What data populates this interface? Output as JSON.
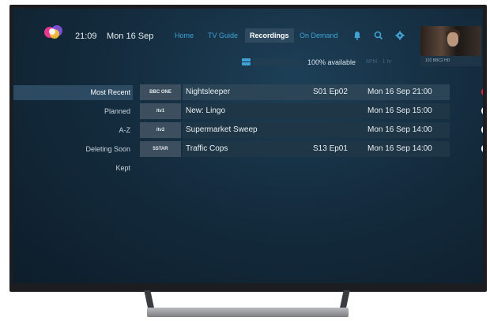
{
  "header": {
    "time": "21:09",
    "date": "Mon 16 Sep",
    "nav": [
      {
        "label": "Home"
      },
      {
        "label": "TV Guide"
      },
      {
        "label": "Recordings",
        "active": true
      },
      {
        "label": "On Demand"
      }
    ],
    "icons": [
      "bell-icon",
      "search-icon",
      "gear-icon"
    ],
    "preview_channel": "102 BBC2 HD"
  },
  "storage": {
    "available_text": "100% available",
    "available_fraction": 1.0,
    "faded_text": "8PM · 1 hr"
  },
  "menu": [
    {
      "label": "Most Recent",
      "active": true
    },
    {
      "label": "Planned"
    },
    {
      "label": "A-Z"
    },
    {
      "label": "Deleting Soon"
    },
    {
      "label": "Kept"
    }
  ],
  "recordings": [
    {
      "channel": "BBC ONE",
      "title": "Nightsleeper",
      "episode": "S01 Ep02",
      "time": "Mon 16 Sep 21:00",
      "status": "recording"
    },
    {
      "channel": "itv1",
      "title": "New: Lingo",
      "episode": "",
      "time": "Mon 16 Sep 15:00",
      "status": "recorded"
    },
    {
      "channel": "itv2",
      "title": "Supermarket Sweep",
      "episode": "",
      "time": "Mon 16 Sep 14:00",
      "status": "recorded"
    },
    {
      "channel": "5STAR",
      "title": "Traffic Cops",
      "episode": "S13 Ep01",
      "time": "Mon 16 Sep 14:00",
      "status": "recorded"
    }
  ],
  "colors": {
    "accent": "#3fa3d6",
    "recording": "#e52133",
    "background": "#142c3e"
  }
}
